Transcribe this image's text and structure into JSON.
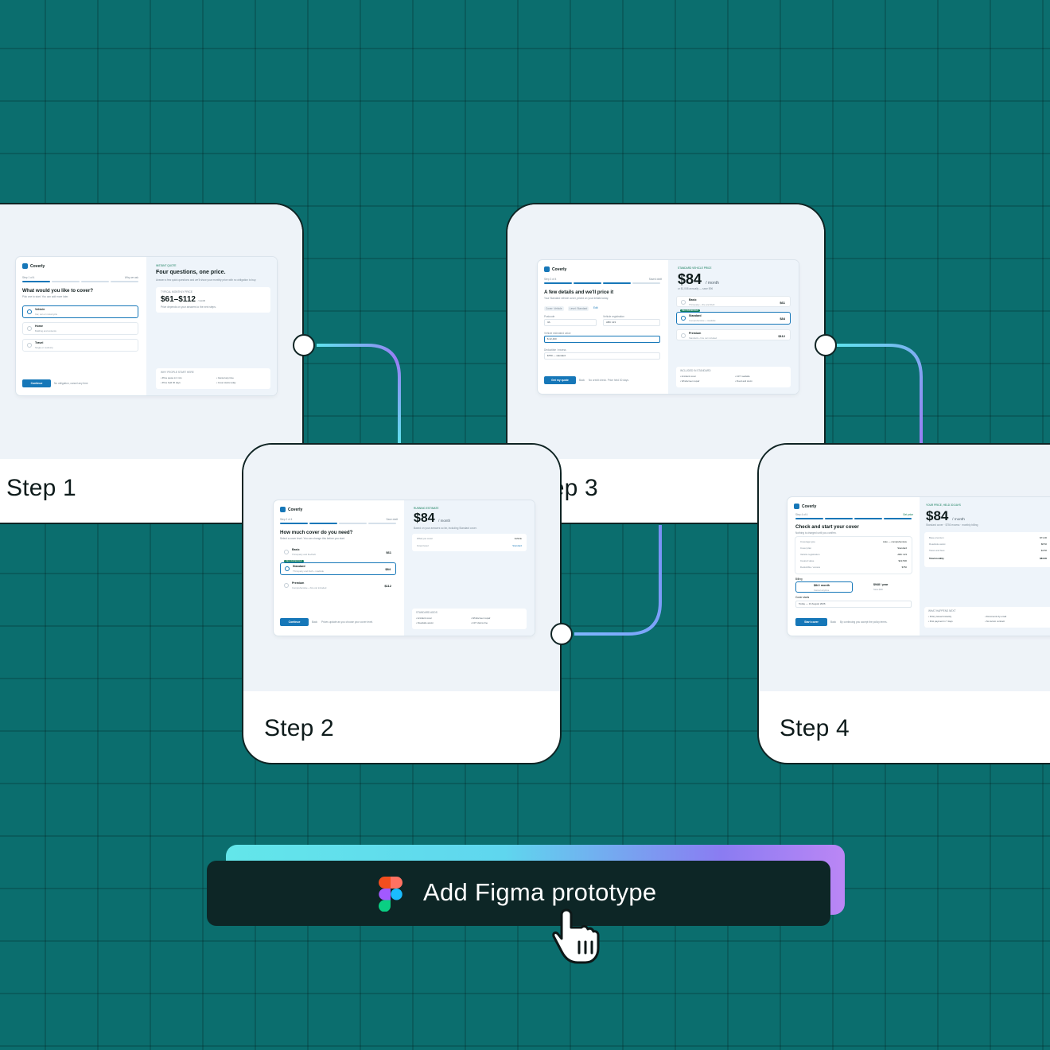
{
  "steps": [
    {
      "label": "Step 1"
    },
    {
      "label": "Step 2"
    },
    {
      "label": "Step 3"
    },
    {
      "label": "Step 4"
    }
  ],
  "screen1": {
    "brand": "Coverly",
    "step": "Step 1 of 4",
    "step_right": "Why we ask",
    "question": "What would you like to cover?",
    "question_sub": "Pick one to start. You can add more later.",
    "options": [
      {
        "label": "Vehicle",
        "sub": "Car, van or motorcycle"
      },
      {
        "label": "Home",
        "sub": "Building and contents"
      },
      {
        "label": "Travel",
        "sub": "Single or multi-trip"
      }
    ],
    "continue": "Continue",
    "footnote": "No obligation, cancel any time",
    "right_kicker": "INSTANT QUOTE",
    "right_title": "Four questions, one price.",
    "right_sub": "Answer a few quick questions and we'll show your monthly price with no obligation to buy.",
    "range_label": "TYPICAL MONTHLY PRICE",
    "range_value": "$61–$112",
    "range_unit": "/ month",
    "range_note": "Price depends on your answers to the next steps.",
    "why_label": "WHY PEOPLE START HERE",
    "why": [
      "Price quote in 2 min",
      "Cancel any time",
      "Price held 30 days",
      "Cover starts today"
    ]
  },
  "screen2": {
    "brand": "Coverly",
    "step": "Step 2 of 4",
    "step_right": "Save draft",
    "question": "How much cover do you need?",
    "question_sub": "Select a cover level. You can change this before you start.",
    "options": [
      {
        "label": "Basic",
        "sub": "Third-party and fire/theft",
        "price": "$61"
      },
      {
        "label": "Standard",
        "sub": "Third-party and theft + roadside",
        "price": "$84",
        "badge": "RECOMMENDED"
      },
      {
        "label": "Premium",
        "sub": "Comprehensive + hire car included",
        "price": "$112"
      }
    ],
    "continue": "Continue",
    "back": "Back",
    "footnote": "Prices update as you choose your cover level.",
    "right_kicker": "RUNNING ESTIMATE",
    "price": "$84",
    "price_unit": "/ month",
    "price_note": "Based on your answers so far, including Standard cover.",
    "summary": [
      {
        "k": "What you cover",
        "v": "Vehicle"
      },
      {
        "k": "Cover level",
        "v": "Standard"
      }
    ],
    "includes_label": "STANDARD ADDS",
    "includes": [
      "Accident cover",
      "Windscreen repair",
      "Roadside assist",
      "24/7 claims line"
    ]
  },
  "screen3": {
    "brand": "Coverly",
    "step": "Step 3 of 4",
    "step_right": "Saved draft",
    "question": "A few details and we'll price it",
    "question_sub": "Your Standard vehicle cover, priced on your details today.",
    "chips": [
      "Cover: Vehicle",
      "Level: Standard",
      "Edit"
    ],
    "field1_label": "Postcode",
    "field1_value": "3A",
    "field2_label": "Vehicle registration",
    "field2_value": "ABC 123",
    "field3_label": "Vehicle estimated value",
    "field3_value": "$ 22,400",
    "field4_label": "Deductible / excess",
    "field4_value": "$750 — standard",
    "cta": "Get my quote",
    "back": "Back",
    "footnote": "No credit check. Price held 30 days.",
    "right_kicker": "STANDARD VEHICLE PRICE",
    "price": "$84",
    "price_unit": "/ month",
    "price_note": "or $1,008 annually — save $96",
    "options": [
      {
        "label": "Basic",
        "sub": "Third-party + fire and theft",
        "price": "$61"
      },
      {
        "label": "Standard",
        "sub": "Comprehensive + roadside",
        "price": "$84",
        "badge": "RECOMMENDED"
      },
      {
        "label": "Premium",
        "sub": "Standard + hire car included",
        "price": "$112"
      }
    ],
    "includes_label": "INCLUDED IN STANDARD",
    "includes": [
      "Accident cover",
      "24/7 roadside",
      "Windscreen repair",
      "Flood and storm"
    ]
  },
  "screen4": {
    "brand": "Coverly",
    "step": "Step 4 of 4",
    "step_right": "Get price",
    "question": "Check and start your cover",
    "question_sub": "Nothing is charged until you confirm.",
    "rows": [
      {
        "k": "Coverage type",
        "v": "Auto — comprehensive"
      },
      {
        "k": "Cover plan",
        "v": "Standard"
      },
      {
        "k": "Vehicle registration",
        "v": "ABC 123"
      },
      {
        "k": "Insured value",
        "v": "$22,500"
      },
      {
        "k": "Deductible / excess",
        "v": "$750"
      }
    ],
    "billing_label": "Billing",
    "billing_monthly": "$84 / month",
    "billing_monthly_sub": "Cancel anytime",
    "billing_yearly": "$948 / year",
    "billing_yearly_sub": "Save $60",
    "start_label": "Cover starts",
    "start_value": "Today — 13 August 2026",
    "cta": "Start cover",
    "back": "Back",
    "footnote": "By continuing you accept the policy terms.",
    "right_kicker": "YOUR PRICE, HELD 30 DAYS",
    "price": "$84",
    "price_unit": "/ month",
    "price_note": "Standard cover · $750 excess · monthly billing",
    "breakdown": [
      {
        "k": "Base premium",
        "v": "$71.00"
      },
      {
        "k": "Roadside assist",
        "v": "$8.50"
      },
      {
        "k": "Taxes and fees",
        "v": "$4.50"
      },
      {
        "k": "Total monthly",
        "v": "$84.00"
      }
    ],
    "what_next_label": "WHAT HAPPENS NEXT",
    "what_next": [
      "Policy issued instantly",
      "Documents by email",
      "First payment in 7 days",
      "No lock-in contract"
    ]
  },
  "cta": {
    "label": "Add Figma prototype"
  },
  "colors": {
    "background": "#0b6e6e",
    "card_border": "#0f2424",
    "accent": "#1677b8",
    "cta_bg": "#0d2626",
    "connector_cyan": "#5fe3ee",
    "connector_violet": "#9a7cf4"
  },
  "icons": [
    "figma-icon",
    "hand-pointer-icon",
    "coverly-logo-icon"
  ]
}
